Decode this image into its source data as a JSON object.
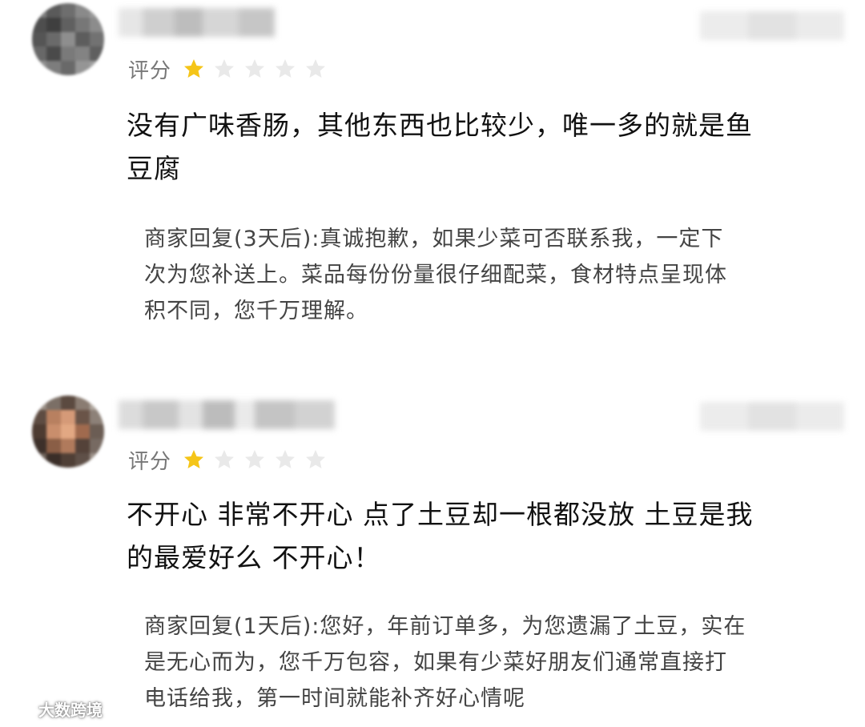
{
  "reviews": [
    {
      "rating_label": "评分",
      "rating": 1,
      "max_rating": 5,
      "comment_lines": [
        "没有广味香肠，其他东西也比较少，唯一多的就是鱼",
        "豆腐"
      ],
      "reply_lines": [
        "商家回复(3天后):真诚抱歉，如果少菜可否联系我，一定下",
        "次为您补送上。菜品每份份量很仔细配菜，食材特点呈现体",
        "积不同，您千万理解。"
      ]
    },
    {
      "rating_label": "评分",
      "rating": 1,
      "max_rating": 5,
      "comment_lines": [
        "不开心 非常不开心 点了土豆却一根都没放 土豆是我",
        "的最爱好么 不开心！"
      ],
      "reply_lines": [
        "商家回复(1天后):您好，年前订单多，为您遗漏了土豆，实在",
        "是无心而为，您千万包容，如果有少菜好朋友们通常直接打",
        "电话给我，第一时间就能补齐好心情呢"
      ]
    }
  ],
  "watermark": {
    "text": "大数跨境",
    "icon": "brand-logo-icon"
  },
  "colors": {
    "star_filled": "#F5C518",
    "star_empty": "#E9E9E9",
    "rating_label": "#777777",
    "reply_text": "#444444"
  }
}
